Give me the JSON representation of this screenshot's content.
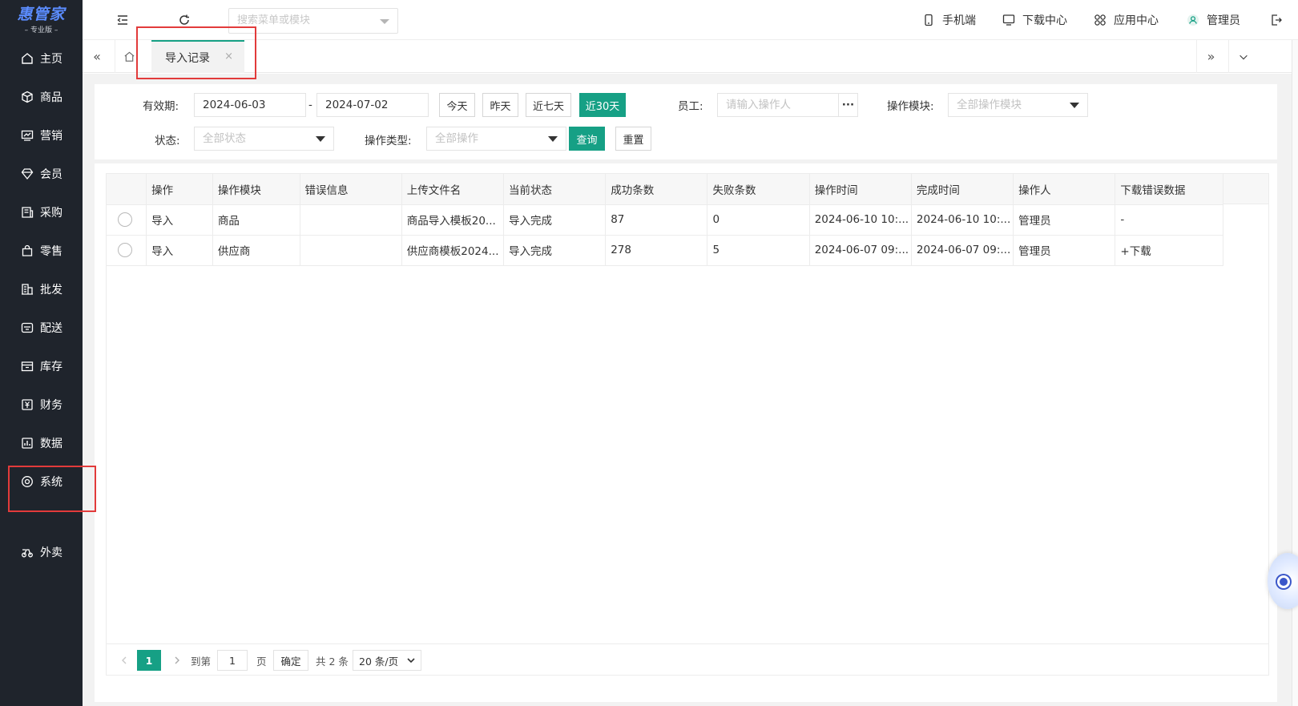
{
  "logo": {
    "name": "惠管家",
    "edition": "专业版"
  },
  "sidebar": {
    "items": [
      {
        "label": "主页",
        "icon": "home-icon"
      },
      {
        "label": "商品",
        "icon": "box-icon"
      },
      {
        "label": "营销",
        "icon": "chart-card-icon"
      },
      {
        "label": "会员",
        "icon": "diamond-icon"
      },
      {
        "label": "采购",
        "icon": "purchase-icon"
      },
      {
        "label": "零售",
        "icon": "bag-icon"
      },
      {
        "label": "批发",
        "icon": "building-icon"
      },
      {
        "label": "配送",
        "icon": "delivery-icon"
      },
      {
        "label": "库存",
        "icon": "inventory-icon"
      },
      {
        "label": "财务",
        "icon": "finance-icon"
      },
      {
        "label": "数据",
        "icon": "data-icon"
      },
      {
        "label": "系统",
        "icon": "system-icon"
      },
      {
        "label": "外卖",
        "icon": "takeout-icon"
      }
    ]
  },
  "topbar": {
    "search_placeholder": "搜索菜单或模块",
    "mobile": "手机端",
    "download_center": "下载中心",
    "app_center": "应用中心",
    "user": "管理员"
  },
  "tabs": [
    {
      "label": "导入记录",
      "close": "×"
    }
  ],
  "filter": {
    "date_label": "有效期:",
    "date_from": "2024-06-03",
    "date_sep": "-",
    "date_to": "2024-07-02",
    "btn_today": "今天",
    "btn_yesterday": "昨天",
    "btn_7days": "近七天",
    "btn_30days": "近30天",
    "employee_label": "员工:",
    "employee_placeholder": "请输入操作人",
    "employee_more": "···",
    "module_label": "操作模块:",
    "module_value": "全部操作模块",
    "status_label": "状态:",
    "status_value": "全部状态",
    "optype_label": "操作类型:",
    "optype_value": "全部操作",
    "btn_query": "查询",
    "btn_reset": "重置"
  },
  "table": {
    "columns": [
      "",
      "操作",
      "操作模块",
      "错误信息",
      "上传文件名",
      "当前状态",
      "成功条数",
      "失败条数",
      "操作时间",
      "完成时间",
      "操作人",
      "下载错误数据"
    ],
    "rows": [
      {
        "op": "导入",
        "module": "商品",
        "error": "",
        "file": "商品导入模板20...",
        "status": "导入完成",
        "success": "87",
        "fail": "0",
        "op_time": "2024-06-10 10:...",
        "done_time": "2024-06-10 10:...",
        "operator": "管理员",
        "download": "-"
      },
      {
        "op": "导入",
        "module": "供应商",
        "error": "",
        "file": "供应商模板2024...",
        "status": "导入完成",
        "success": "278",
        "fail": "5",
        "op_time": "2024-06-07 09:...",
        "done_time": "2024-06-07 09:...",
        "operator": "管理员",
        "download": "+下载"
      }
    ]
  },
  "pager": {
    "current": "1",
    "goto_label": "到第",
    "goto_value": "1",
    "page_unit": "页",
    "confirm": "确定",
    "total": "共 2 条",
    "page_size": "20 条/页"
  },
  "colors": {
    "accent": "#16a085",
    "sidebar_bg": "#1f242c",
    "highlight": "#e23b3b",
    "error": "#e53935"
  }
}
